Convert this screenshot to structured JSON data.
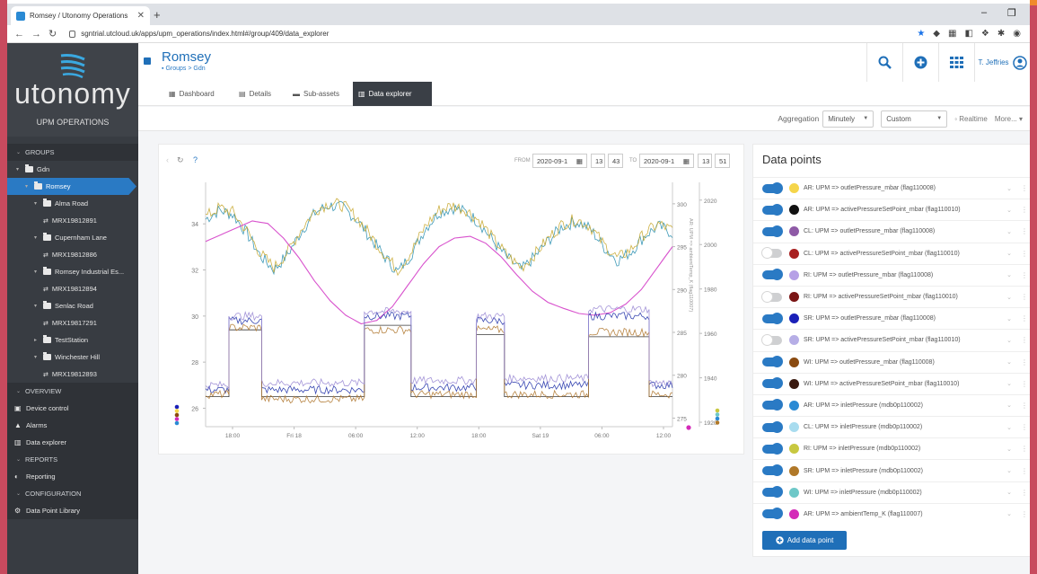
{
  "browser": {
    "tab_title": "Romsey / Utonomy Operations",
    "url": "sgntrial.utcloud.uk/apps/upm_operations/index.html#/group/409/data_explorer"
  },
  "sidebar": {
    "brand": "utonomy",
    "app_name": "UPM OPERATIONS",
    "items": [
      {
        "label": "GROUPS",
        "kind": "section",
        "indent": 0
      },
      {
        "label": "Gdn",
        "kind": "folder",
        "indent": 1
      },
      {
        "label": "Romsey",
        "kind": "folder",
        "indent": 2,
        "active": true
      },
      {
        "label": "Alma Road",
        "kind": "folder",
        "indent": 3
      },
      {
        "label": "MRX19812891",
        "kind": "device",
        "indent": 4
      },
      {
        "label": "Cupernham Lane",
        "kind": "folder",
        "indent": 3
      },
      {
        "label": "MRX19812886",
        "kind": "device",
        "indent": 4
      },
      {
        "label": "Romsey Industrial Es...",
        "kind": "folder",
        "indent": 3
      },
      {
        "label": "MRX19812894",
        "kind": "device",
        "indent": 4
      },
      {
        "label": "Senlac Road",
        "kind": "folder",
        "indent": 3
      },
      {
        "label": "MRX19817291",
        "kind": "device",
        "indent": 4
      },
      {
        "label": "TestStation",
        "kind": "folder",
        "indent": 3,
        "collapsed": true
      },
      {
        "label": "Winchester Hill",
        "kind": "folder",
        "indent": 3
      },
      {
        "label": "MRX19812893",
        "kind": "device",
        "indent": 4
      },
      {
        "label": "OVERVIEW",
        "kind": "section",
        "indent": 0
      },
      {
        "label": "Device control",
        "kind": "link",
        "icon": "monitor-icon"
      },
      {
        "label": "Alarms",
        "kind": "link",
        "icon": "bell-icon"
      },
      {
        "label": "Data explorer",
        "kind": "link",
        "icon": "chart-icon"
      },
      {
        "label": "REPORTS",
        "kind": "section",
        "indent": 0
      },
      {
        "label": "Reporting",
        "kind": "link",
        "icon": "report-icon"
      },
      {
        "label": "CONFIGURATION",
        "kind": "section",
        "indent": 0
      },
      {
        "label": "Data Point Library",
        "kind": "link",
        "icon": "library-icon"
      }
    ]
  },
  "header": {
    "title": "Romsey",
    "breadcrumb": "Groups > Gdn",
    "user": "T. Jeffries"
  },
  "tabs": [
    {
      "label": "Dashboard",
      "icon": "grid-icon"
    },
    {
      "label": "Details",
      "icon": "doc-icon"
    },
    {
      "label": "Sub-assets",
      "icon": "folders-icon"
    },
    {
      "label": "Data explorer",
      "icon": "chart-icon",
      "active": true
    }
  ],
  "toolbar": {
    "aggregation_label": "Aggregation",
    "aggregation_value": "Minutely",
    "range_value": "Custom",
    "realtime": "Realtime",
    "more": "More..."
  },
  "chart_controls": {
    "from_label": "FROM",
    "from_date": "2020-09-1",
    "from_hour": "13",
    "from_min": "43",
    "to_label": "TO",
    "to_date": "2020-09-1",
    "to_hour": "13",
    "to_min": "51"
  },
  "chart_data": {
    "type": "line",
    "x_ticks": [
      "18:00",
      "Fri 18",
      "06:00",
      "12:00",
      "18:00",
      "Sat 19",
      "06:00",
      "12:00"
    ],
    "y_left": {
      "ticks": [
        26,
        28,
        30,
        32,
        34
      ],
      "range": [
        25.2,
        35.8
      ]
    },
    "y_right1": {
      "ticks": [
        275,
        280,
        285,
        290,
        295,
        300
      ],
      "range": [
        274,
        302.5
      ],
      "label": "AR: UPM => ambientTemp_K (flag110007)"
    },
    "y_right2": {
      "ticks": [
        1920,
        1940,
        1960,
        1980,
        2000,
        2020
      ],
      "range": [
        1918,
        2028
      ]
    },
    "series": [
      {
        "key": "outlet",
        "color": "#2a8fb0",
        "axis": "left",
        "values": [
          34.2,
          34.6,
          34.4,
          33.6,
          32.6,
          32.0,
          32.7,
          33.7,
          34.5,
          34.8,
          34.7,
          34.2,
          33.4,
          32.6,
          31.9,
          32.7,
          33.8,
          34.5,
          34.7,
          34.5,
          34.0,
          33.2,
          32.5,
          32.0,
          32.6,
          33.3,
          33.9,
          34.1,
          33.8,
          33.0,
          32.4,
          32.8,
          33.5,
          33.9,
          33.6
        ],
        "style": "noisy"
      },
      {
        "key": "outlet-b",
        "color": "#c8a830",
        "axis": "left",
        "values": [
          34.3,
          34.7,
          34.5,
          33.7,
          32.7,
          32.1,
          32.8,
          33.8,
          34.6,
          34.9,
          34.8,
          34.3,
          33.5,
          32.7,
          32.0,
          32.8,
          33.9,
          34.6,
          34.8,
          34.6,
          34.1,
          33.3,
          32.6,
          32.1,
          32.7,
          33.4,
          34.0,
          34.2,
          33.9,
          33.1,
          32.5,
          32.9,
          33.6,
          34.0,
          33.7
        ],
        "style": "noisy"
      },
      {
        "key": "ambient",
        "color": "#d43fc8",
        "axis": "right1",
        "values": [
          295.6,
          296.4,
          297.2,
          298.0,
          297.7,
          296.0,
          293.7,
          291.0,
          288.7,
          287.0,
          286.0,
          286.4,
          288.0,
          290.5,
          293.0,
          295.0,
          296.0,
          296.2,
          295.4,
          293.8,
          291.7,
          289.8,
          288.5,
          287.8,
          287.2,
          287.0,
          287.3,
          288.3,
          290.0,
          292.5,
          295.0
        ],
        "style": "smooth"
      },
      {
        "key": "setpoint",
        "color": "#222222",
        "axis": "left",
        "steps": [
          [
            0,
            26.5
          ],
          [
            0.05,
            29.4
          ],
          [
            0.12,
            26.5
          ],
          [
            0.34,
            29.6
          ],
          [
            0.44,
            26.5
          ],
          [
            0.58,
            29.2
          ],
          [
            0.64,
            26.5
          ],
          [
            0.82,
            29.1
          ],
          [
            0.95,
            26.5
          ],
          [
            1.0,
            26.5
          ]
        ],
        "style": "step"
      },
      {
        "key": "setpoint-b",
        "color": "#2233aa",
        "axis": "left",
        "steps": [
          [
            0,
            26.8
          ],
          [
            0.05,
            29.8
          ],
          [
            0.12,
            26.8
          ],
          [
            0.34,
            30.0
          ],
          [
            0.44,
            26.9
          ],
          [
            0.58,
            29.8
          ],
          [
            0.64,
            27.0
          ],
          [
            0.82,
            30.0
          ],
          [
            0.95,
            27.0
          ],
          [
            1.0,
            27.0
          ]
        ],
        "style": "stepnoisy"
      },
      {
        "key": "setpoint-c",
        "color": "#b07830",
        "axis": "left",
        "steps": [
          [
            0,
            26.6
          ],
          [
            0.05,
            29.5
          ],
          [
            0.12,
            26.4
          ],
          [
            0.34,
            29.4
          ],
          [
            0.44,
            26.6
          ],
          [
            0.58,
            29.4
          ],
          [
            0.64,
            26.6
          ],
          [
            0.82,
            29.3
          ],
          [
            0.95,
            26.6
          ],
          [
            1.0,
            26.6
          ]
        ],
        "style": "stepnoisy"
      },
      {
        "key": "setpoint-d",
        "color": "#9a8ad4",
        "axis": "left",
        "steps": [
          [
            0,
            27.0
          ],
          [
            0.05,
            30.0
          ],
          [
            0.12,
            27.1
          ],
          [
            0.34,
            30.2
          ],
          [
            0.44,
            27.2
          ],
          [
            0.58,
            30.0
          ],
          [
            0.64,
            27.3
          ],
          [
            0.82,
            30.3
          ],
          [
            0.95,
            27.1
          ],
          [
            1.0,
            27.1
          ]
        ],
        "style": "stepnoisy"
      }
    ]
  },
  "data_points": {
    "title": "Data points",
    "add_label": "Add data point",
    "items": [
      {
        "label": "AR: UPM => outletPressure_mbar (flag110008)",
        "color": "#f5d54a",
        "on": true
      },
      {
        "label": "AR: UPM => activePressureSetPoint_mbar (flag110010)",
        "color": "#111111",
        "on": true
      },
      {
        "label": "CL: UPM => outletPressure_mbar (flag110008)",
        "color": "#8e5aa6",
        "on": true
      },
      {
        "label": "CL: UPM => activePressureSetPoint_mbar (flag110010)",
        "color": "#a82020",
        "on": false
      },
      {
        "label": "RI: UPM => outletPressure_mbar (flag110008)",
        "color": "#b6a0e6",
        "on": true
      },
      {
        "label": "RI: UPM => activePressureSetPoint_mbar (flag110010)",
        "color": "#7a1515",
        "on": false
      },
      {
        "label": "SR: UPM => outletPressure_mbar (flag110008)",
        "color": "#1a20b8",
        "on": true
      },
      {
        "label": "SR: UPM => activePressureSetPoint_mbar (flag110010)",
        "color": "#b6aee6",
        "on": false
      },
      {
        "label": "WI: UPM => outletPressure_mbar (flag110008)",
        "color": "#8a4a10",
        "on": true
      },
      {
        "label": "WI: UPM => activePressureSetPoint_mbar (flag110010)",
        "color": "#3a1a10",
        "on": true
      },
      {
        "label": "AR: UPM => inletPressure (mdb0p110002)",
        "color": "#2a8ad4",
        "on": true
      },
      {
        "label": "CL: UPM => inletPressure (mdb0p110002)",
        "color": "#a8dcef",
        "on": true
      },
      {
        "label": "RI: UPM => inletPressure (mdb0p110002)",
        "color": "#c8c840",
        "on": true
      },
      {
        "label": "SR: UPM => inletPressure (mdb0p110002)",
        "color": "#b07828",
        "on": true
      },
      {
        "label": "WI: UPM => inletPressure (mdb0p110002)",
        "color": "#6ec8c8",
        "on": true
      },
      {
        "label": "AR: UPM => ambientTemp_K (flag110007)",
        "color": "#d42ab8",
        "on": true
      }
    ]
  }
}
